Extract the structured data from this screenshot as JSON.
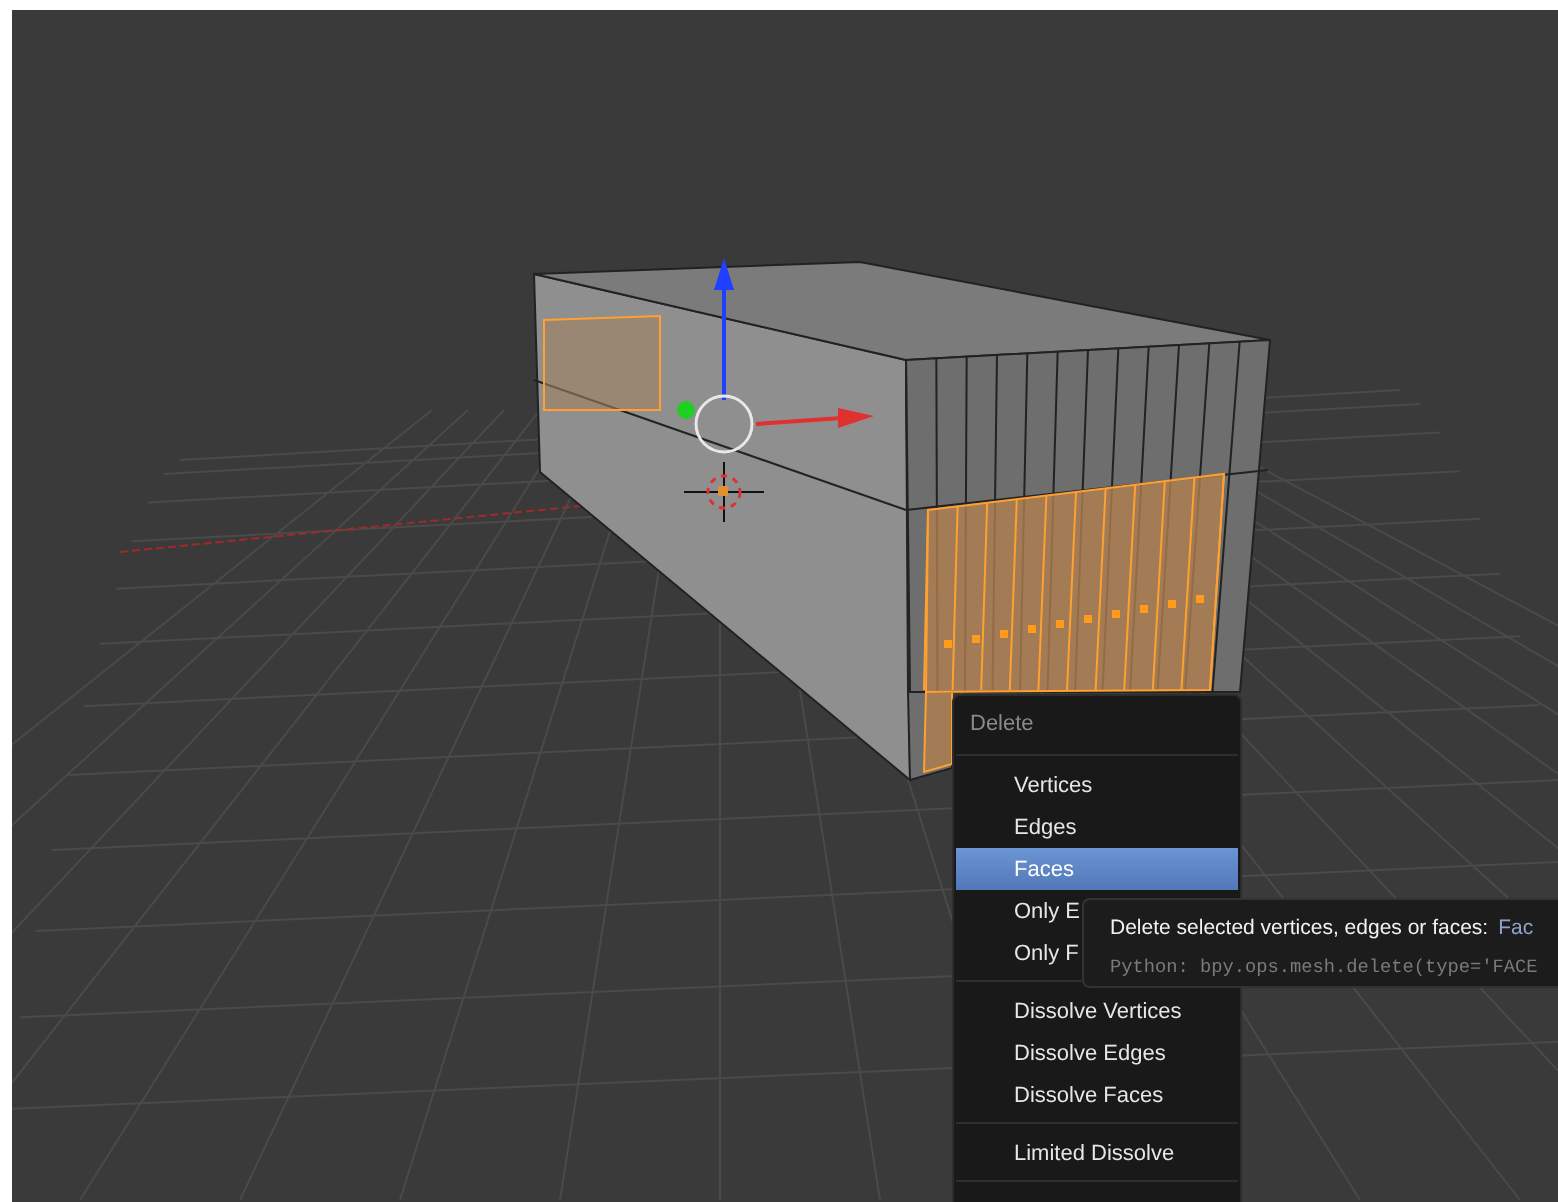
{
  "menu": {
    "title": "Delete",
    "sections": [
      {
        "items": [
          {
            "label": "Vertices",
            "selected": false
          },
          {
            "label": "Edges",
            "selected": false
          },
          {
            "label": "Faces",
            "selected": true
          },
          {
            "label": "Only E",
            "selected": false
          },
          {
            "label": "Only F",
            "selected": false
          }
        ]
      },
      {
        "items": [
          {
            "label": "Dissolve Vertices",
            "selected": false
          },
          {
            "label": "Dissolve Edges",
            "selected": false
          },
          {
            "label": "Dissolve Faces",
            "selected": false
          }
        ]
      },
      {
        "items": [
          {
            "label": "Limited Dissolve",
            "selected": false
          }
        ]
      }
    ]
  },
  "tooltip": {
    "description": "Delete selected vertices, edges or faces:",
    "value": "Fac",
    "python": "Python: bpy.ops.mesh.delete(type='FACE"
  }
}
